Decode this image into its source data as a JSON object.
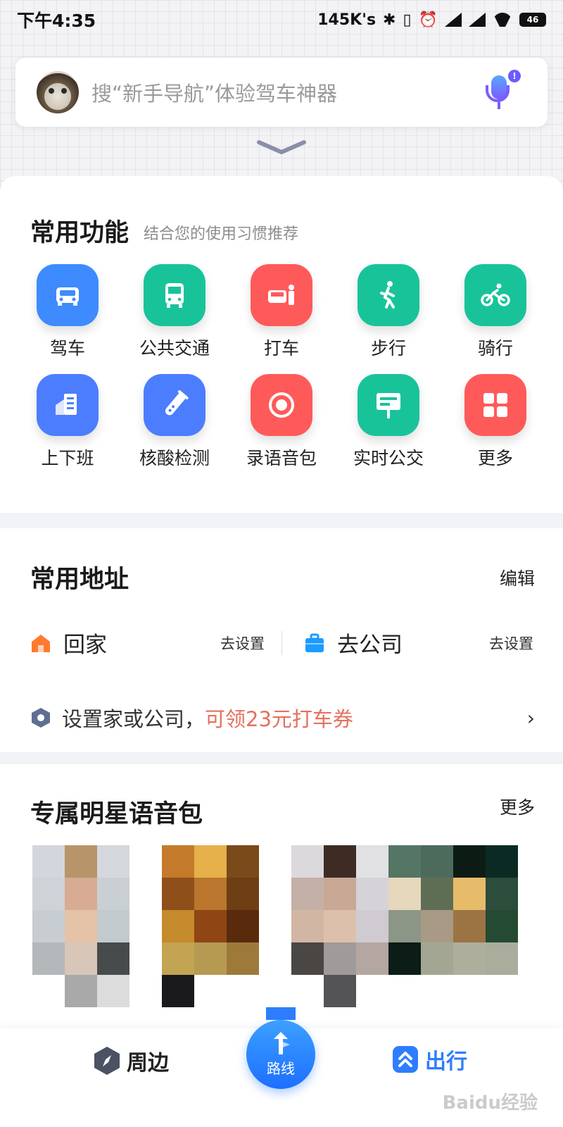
{
  "status_bar": {
    "time": "下午4:35",
    "net_speed": "145K's",
    "battery_level": "46"
  },
  "search": {
    "placeholder": "搜“新手导航”体验驾车神器",
    "avatar": "cat-avatar",
    "mic_badge": "!"
  },
  "common_functions": {
    "title": "常用功能",
    "subtitle": "结合您的使用习惯推荐",
    "items": [
      {
        "label": "驾车",
        "icon": "car-icon",
        "color": "#3d8bff"
      },
      {
        "label": "公共交通",
        "icon": "bus-icon",
        "color": "#19c39a"
      },
      {
        "label": "打车",
        "icon": "taxi-icon",
        "color": "#ff5a5a"
      },
      {
        "label": "步行",
        "icon": "walk-icon",
        "color": "#19c39a"
      },
      {
        "label": "骑行",
        "icon": "bike-icon",
        "color": "#19c39a"
      },
      {
        "label": "上下班",
        "icon": "commute-icon",
        "color": "#4c7dff"
      },
      {
        "label": "核酸检测",
        "icon": "test-tube-icon",
        "color": "#4c7dff"
      },
      {
        "label": "录语音包",
        "icon": "record-icon",
        "color": "#ff5a5a"
      },
      {
        "label": "实时公交",
        "icon": "bus-stop-icon",
        "color": "#19c39a"
      },
      {
        "label": "更多",
        "icon": "grid-icon",
        "color": "#ff5a5a"
      }
    ]
  },
  "common_addresses": {
    "title": "常用地址",
    "edit_label": "编辑",
    "home": {
      "label": "回家",
      "action": "去设置"
    },
    "work": {
      "label": "去公司",
      "action": "去设置"
    },
    "promo_text": "设置家或公司，",
    "promo_highlight": "可领23元打车券",
    "promo_arrow": "›"
  },
  "voice_packs": {
    "title": "专属明星语音包",
    "more_label": "更多"
  },
  "bottom_nav": {
    "nearby": "周边",
    "route": "路线",
    "travel": "出行"
  },
  "watermark": "Baidu经验"
}
